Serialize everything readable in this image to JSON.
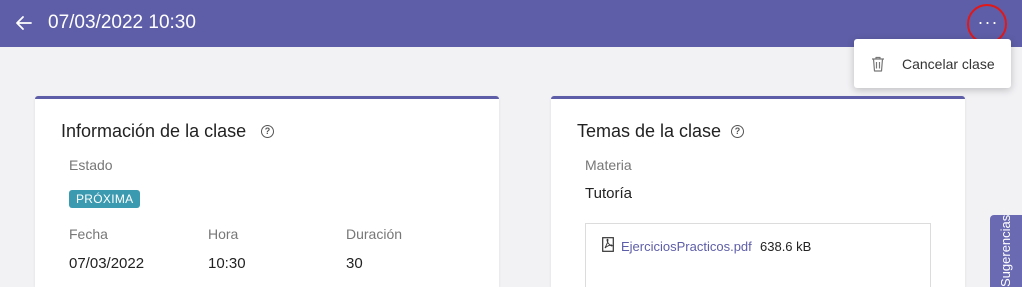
{
  "header": {
    "back_icon": "arrow-left-icon",
    "title": "07/03/2022 10:30",
    "more_icon": "ellipsis-horizontal-icon",
    "more_label": "···",
    "colors": {
      "bar": "#5e5ea8",
      "highlight": "#e21818"
    }
  },
  "menu": {
    "items": [
      {
        "icon": "trash-icon",
        "label": "Cancelar clase"
      }
    ]
  },
  "info_card": {
    "title": "Información de la clase",
    "help_icon": "help-circle-icon",
    "status_label": "Estado",
    "status_badge": "PRÓXIMA",
    "status_color": "#3b9ab0",
    "date_label": "Fecha",
    "date_value": "07/03/2022",
    "time_label": "Hora",
    "time_value": "10:30",
    "duration_label": "Duración",
    "duration_value": "30"
  },
  "topics_card": {
    "title": "Temas de la clase",
    "help_icon": "help-circle-icon",
    "subject_label": "Materia",
    "subject_value": "Tutoría",
    "file": {
      "icon": "pdf-file-icon",
      "name": "EjerciciosPracticos.pdf",
      "size": "638.6 kB"
    }
  },
  "side_tab": {
    "label": "Sugerencias"
  }
}
